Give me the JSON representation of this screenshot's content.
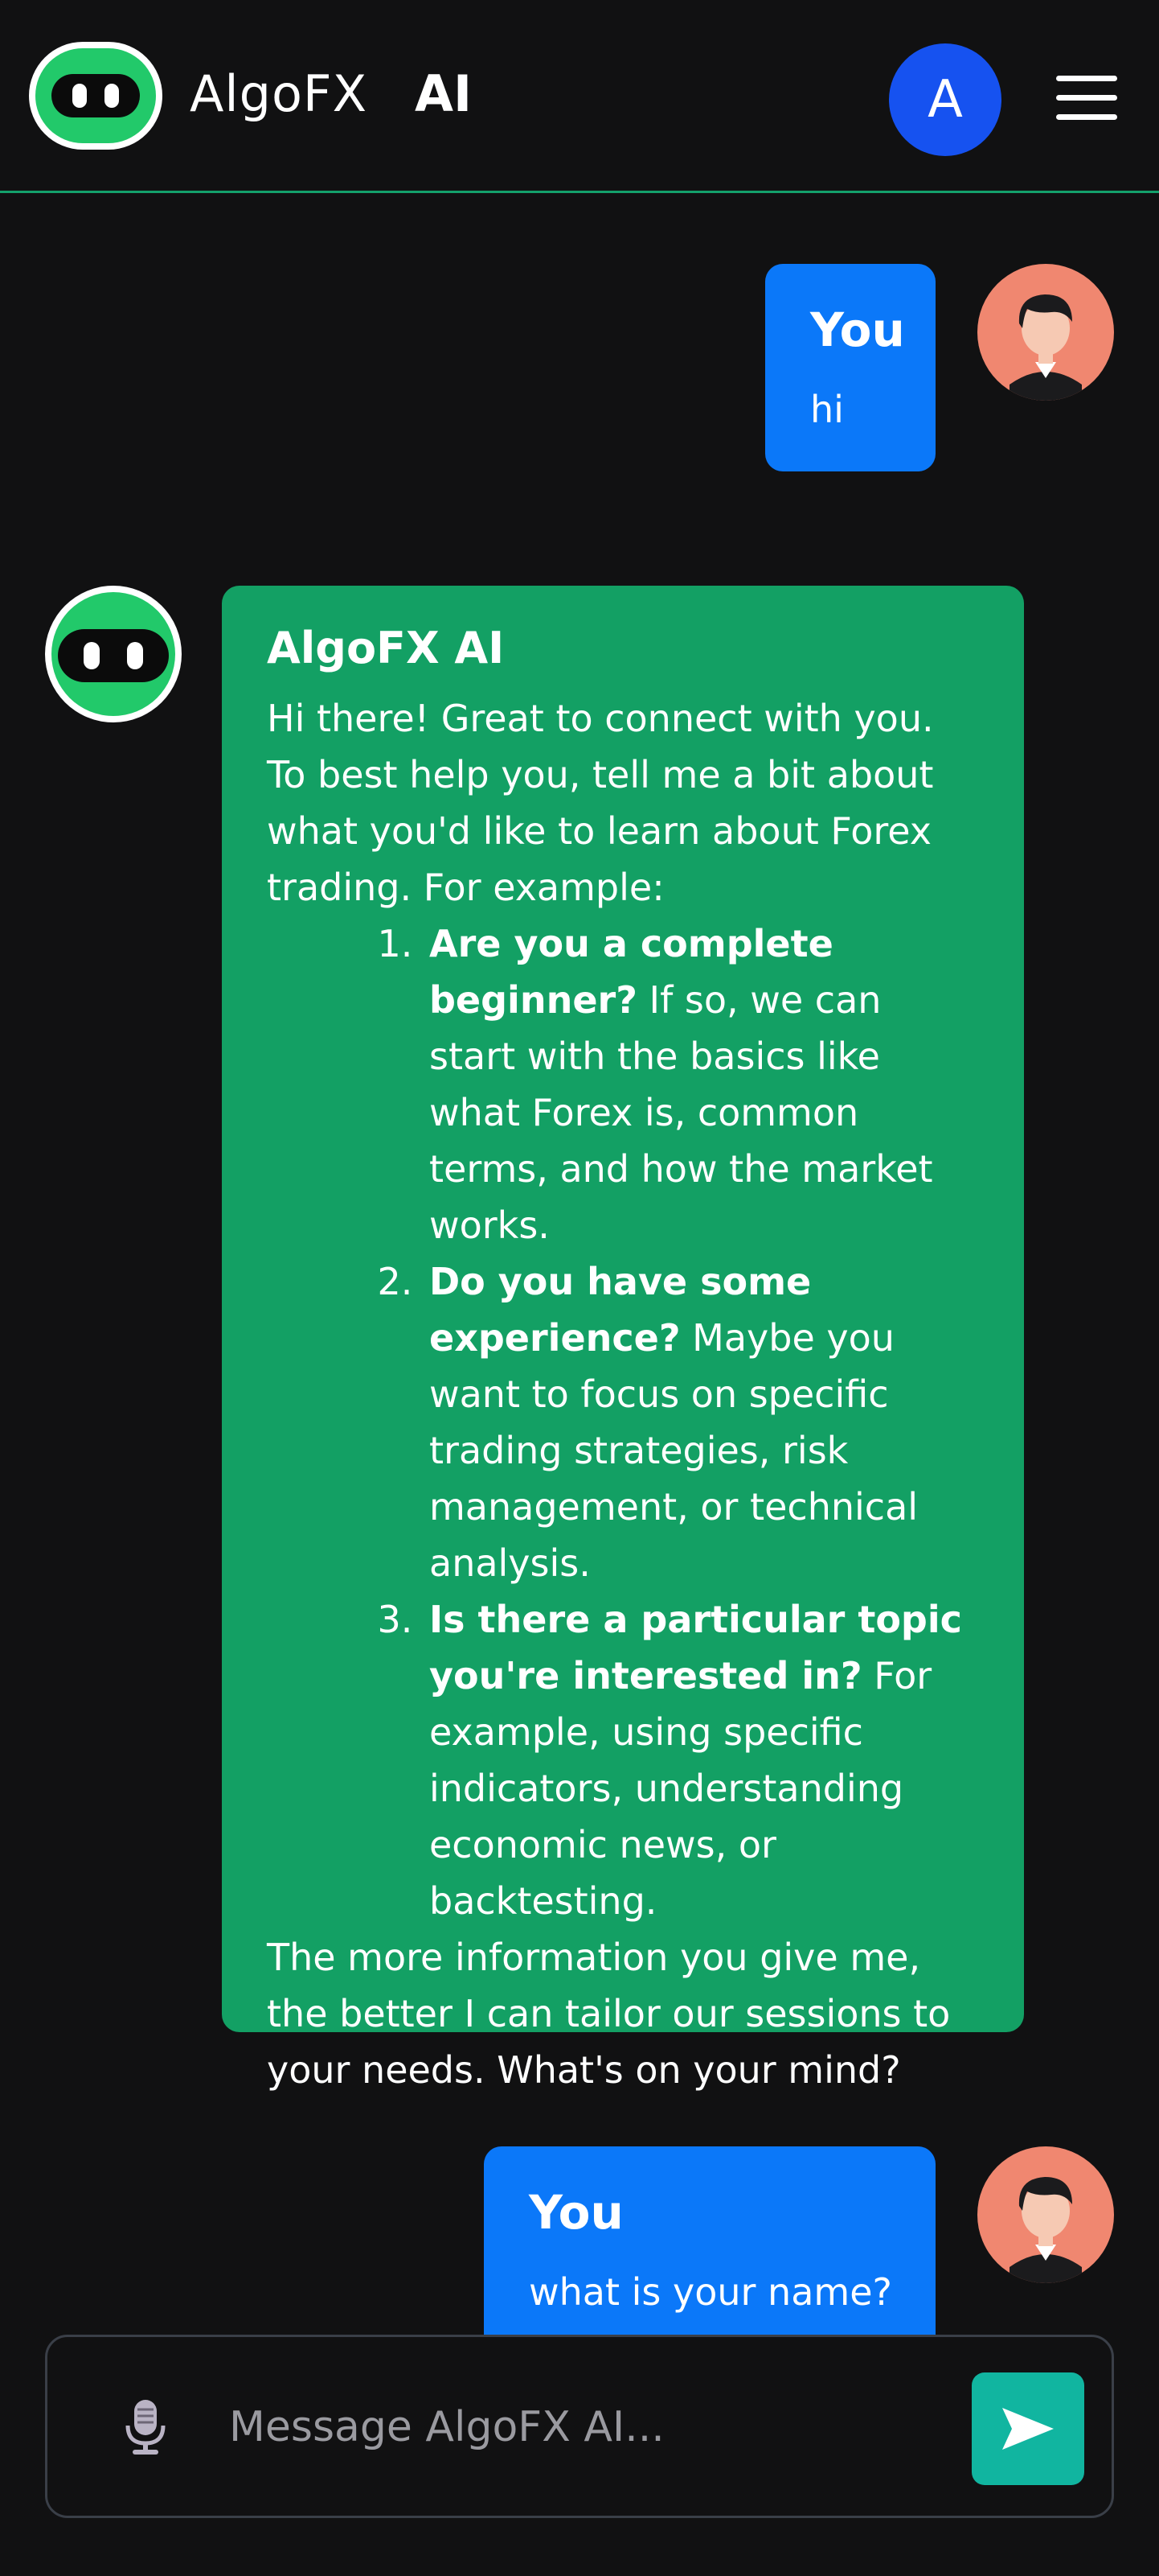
{
  "header": {
    "brand_name": "AlgoFX",
    "brand_suffix": "AI",
    "account_initial": "A"
  },
  "messages": [
    {
      "sender": "You",
      "text": "hi"
    },
    {
      "sender": "AlgoFX AI",
      "intro": "Hi there! Great to connect with you. To best help you, tell me a bit about what you'd like to learn about Forex trading. For example:",
      "list": [
        {
          "bold": "Are you a complete beginner?",
          "rest": " If so, we can start with the basics like what Forex is, common terms, and how the market works."
        },
        {
          "bold": "Do you have some experience?",
          "rest": " Maybe you want to focus on specific trading strategies, risk management, or technical analysis."
        },
        {
          "bold": "Is there a particular topic you're interested in?",
          "rest": " For example, using specific indicators, understanding economic news, or backtesting."
        }
      ],
      "outro": "The more information you give me, the better I can tailor our sessions to your needs. What's on your mind?"
    },
    {
      "sender": "You",
      "text": "what is your name?"
    }
  ],
  "composer": {
    "placeholder": "Message AlgoFX AI...",
    "value": ""
  },
  "colors": {
    "background": "#111112",
    "user_bubble": "#0b78f9",
    "bot_bubble": "#13a064",
    "accent_line": "#14a06b",
    "send_button": "#11b5a0",
    "account_avatar": "#1652f0",
    "user_avatar": "#f08770"
  },
  "icons": [
    "robot-logo-icon",
    "hamburger-menu-icon",
    "user-avatar-icon",
    "microphone-icon",
    "send-icon"
  ]
}
